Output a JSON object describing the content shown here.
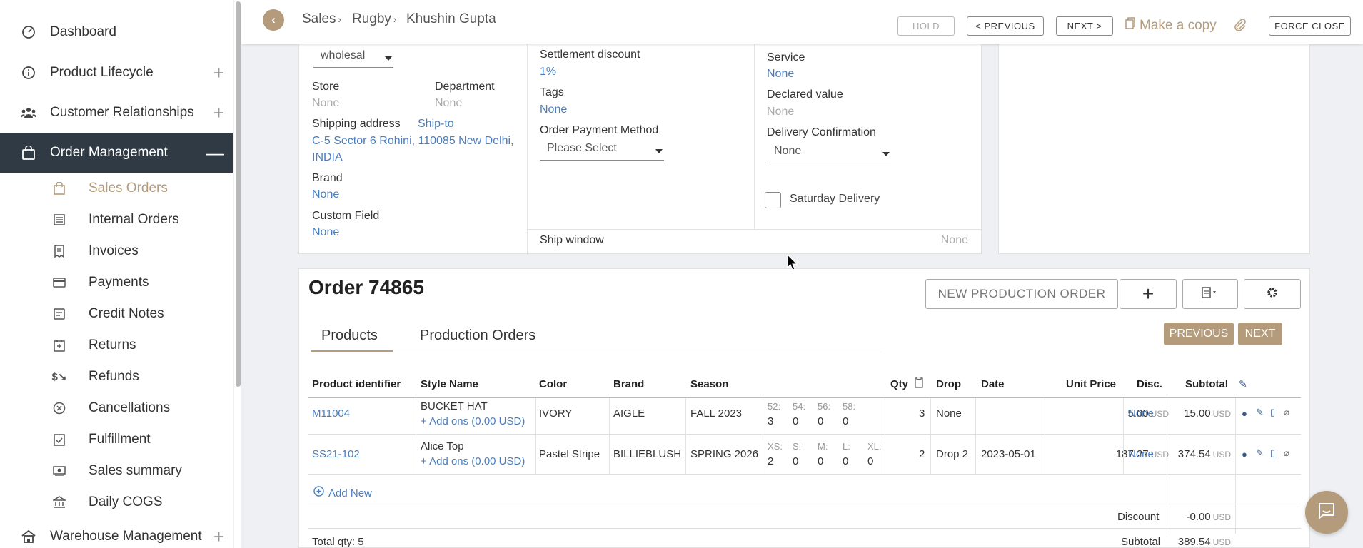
{
  "sidebar": {
    "items": [
      {
        "label": "Dashboard",
        "icon": "dashboard-icon"
      },
      {
        "label": "Product Lifecycle",
        "icon": "info-icon"
      },
      {
        "label": "Customer Relationships",
        "icon": "people-icon"
      },
      {
        "label": "Order Management",
        "icon": "bag-icon"
      },
      {
        "label": "Warehouse Management",
        "icon": "warehouse-icon"
      }
    ],
    "sub_items": [
      {
        "label": "Sales Orders"
      },
      {
        "label": "Internal Orders"
      },
      {
        "label": "Invoices"
      },
      {
        "label": "Payments"
      },
      {
        "label": "Credit Notes"
      },
      {
        "label": "Returns"
      },
      {
        "label": "Refunds"
      },
      {
        "label": "Cancellations"
      },
      {
        "label": "Fulfillment"
      },
      {
        "label": "Sales summary"
      },
      {
        "label": "Daily COGS"
      }
    ]
  },
  "topbar": {
    "breadcrumbs": [
      "Sales",
      "Rugby",
      "Khushin Gupta"
    ],
    "hold": "HOLD",
    "previous": "< PREVIOUS",
    "next": "NEXT >",
    "copy": "Make a copy",
    "force_close": "FORCE CLOSE"
  },
  "info": {
    "price_list_value": "wholesal",
    "store_label": "Store",
    "store_value": "None",
    "department_label": "Department",
    "department_value": "None",
    "shipping_label": "Shipping address",
    "ship_to": "Ship-to",
    "shipping_line1": "C-5 Sector 6 Rohini, 110085 New Delhi,",
    "shipping_line2": "INDIA",
    "brand_label": "Brand",
    "brand_value": "None",
    "custom_label": "Custom Field",
    "custom_value": "None",
    "settlement_label": "Settlement discount",
    "settlement_value": "1%",
    "tags_label": "Tags",
    "tags_value": "None",
    "payment_label": "Order Payment Method",
    "payment_value": "Please Select",
    "ship_window_label": "Ship window",
    "ship_window_value": "None",
    "service_label": "Service",
    "service_value": "None",
    "declared_label": "Declared value",
    "declared_value": "None",
    "delivery_label": "Delivery Confirmation",
    "delivery_value": "None",
    "saturday_label": "Saturday Delivery"
  },
  "order": {
    "title": "Order 74865",
    "new_production": "NEW PRODUCTION ORDER",
    "tabs": [
      "Products",
      "Production Orders"
    ],
    "previous": "PREVIOUS",
    "next": "NEXT",
    "columns": [
      "Product identifier",
      "Style Name",
      "Color",
      "Brand",
      "Season",
      "Qty",
      "Drop",
      "Date",
      "Unit Price",
      "Disc.",
      "Subtotal"
    ],
    "rows": [
      {
        "id": "M11004",
        "style": "BUCKET HAT",
        "addons": "+ Add ons (0.00 USD)",
        "color": "IVORY",
        "brand": "AIGLE",
        "season": "FALL 2023",
        "sizes": [
          {
            "l": "52:",
            "v": "3"
          },
          {
            "l": "54:",
            "v": "0"
          },
          {
            "l": "56:",
            "v": "0"
          },
          {
            "l": "58:",
            "v": "0"
          }
        ],
        "qty": "3",
        "drop": "None",
        "date": "",
        "unit_price": "5.00",
        "disc": "None",
        "subtotal": "15.00"
      },
      {
        "id": "SS21-102",
        "style": "Alice Top",
        "addons": "+ Add ons (0.00 USD)",
        "color": "Pastel Stripe",
        "brand": "BILLIEBLUSH",
        "season": "SPRING 2026",
        "sizes": [
          {
            "l": "XS:",
            "v": "2"
          },
          {
            "l": "S:",
            "v": "0"
          },
          {
            "l": "M:",
            "v": "0"
          },
          {
            "l": "L:",
            "v": "0"
          },
          {
            "l": "XL:",
            "v": "0"
          }
        ],
        "qty": "2",
        "drop": "Drop 2",
        "date": "2023-05-01",
        "unit_price": "187.27",
        "disc": "None",
        "subtotal": "374.54"
      }
    ],
    "currency": "USD",
    "add_new": "Add New",
    "discount_label": "Discount",
    "discount_value": "-0.00",
    "total_qty": "Total qty: 5",
    "subtotal_label": "Subtotal",
    "subtotal_value": "389.54"
  }
}
